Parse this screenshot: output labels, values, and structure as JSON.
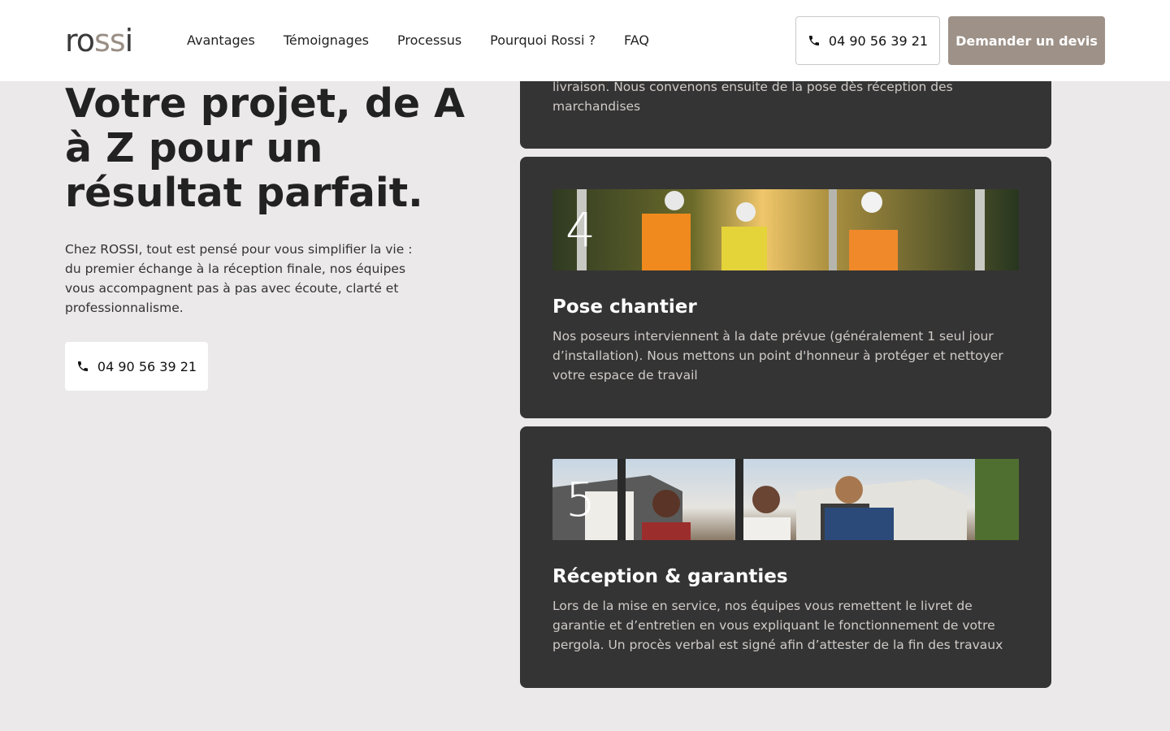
{
  "header": {
    "logo": {
      "part1": "ro",
      "part2": "ss",
      "part3": "i",
      "brand_color": "#9d9188"
    },
    "nav": [
      "Avantages",
      "Témoignages",
      "Processus",
      "Pourquoi Rossi ?",
      "FAQ"
    ],
    "phone": "04 90 56 39 21",
    "cta": "Demander un devis"
  },
  "hero": {
    "title": "Votre projet, de A à Z pour un résultat parfait.",
    "text": "Chez ROSSI, tout est pensé pour vous simplifier la vie : du premier échange à la réception finale, nos équipes vous accompagnent pas à pas avec écoute, clarté et professionnalisme.",
    "phone": "04 90 56 39 21"
  },
  "steps": {
    "partial": {
      "text": "livraison. Nous convenons ensuite de la pose dès réception des marchandises"
    },
    "step4": {
      "number": "4",
      "title": "Pose chantier",
      "body": "Nos poseurs interviennent à la date prévue (généralement 1 seul jour d’installation). Nous mettons un point d'honneur à protéger et nettoyer votre espace de travail"
    },
    "step5": {
      "number": "5",
      "title": "Réception & garanties",
      "body": "Lors de la mise en service, nos équipes vous remettent le livret de garantie et d’entretien en vous expliquant le fonctionnement de votre pergola. Un procès verbal est signé afin d’attester de la fin des travaux"
    }
  },
  "colors": {
    "page_bg": "#ebe9ea",
    "card_bg": "#353434",
    "cta_bg": "#9d9188"
  }
}
